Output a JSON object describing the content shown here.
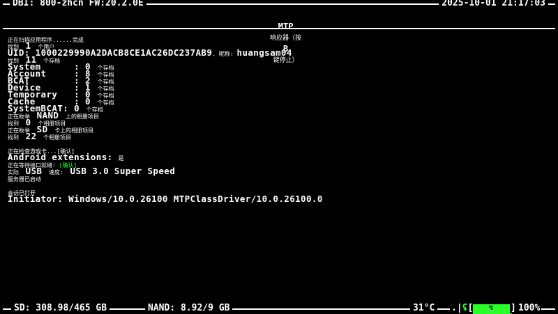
{
  "header": {
    "left": "DBI: 800-zhcn FW:20.2.0E",
    "title": "MTP",
    "subtitle_prefix": "响应器（按",
    "key": "B",
    "subtitle_suffix": "键停止）",
    "datetime": "2025-10-01 21:17:03"
  },
  "log": {
    "scan_apps": "正在扫描应用程序......完成",
    "found_users_pre": "找到",
    "users_count": "1",
    "found_users_post": "个用户",
    "uid_label": "UID: ",
    "uid_value": "1000229990A2DACB8CE1AC26DC237AB9",
    "nick_label": ", 昵称: ",
    "nick_value": "huangsam04",
    "found_saves_pre": "找到",
    "saves_count": "11",
    "found_saves_post": "个存档",
    "save_rows": [
      {
        "name": "System      ",
        "sep": ": ",
        "count": "0",
        "unit": "个存档"
      },
      {
        "name": "Account     ",
        "sep": ": ",
        "count": "8",
        "unit": "个存档"
      },
      {
        "name": "BCAT        ",
        "sep": ": ",
        "count": "2",
        "unit": "个存档"
      },
      {
        "name": "Device      ",
        "sep": ": ",
        "count": "1",
        "unit": "个存档"
      },
      {
        "name": "Temporary   ",
        "sep": ": ",
        "count": "0",
        "unit": "个存档"
      },
      {
        "name": "Cache       ",
        "sep": ": ",
        "count": "0",
        "unit": "个存档"
      },
      {
        "name": "SystemBCAT",
        "sep": ": ",
        "count": "0",
        "unit": "个存档"
      }
    ],
    "enum_nand_pre": "正在枚举",
    "enum_nand_mid": "NAND",
    "enum_nand_post": "上的相册项目",
    "found_album1_pre": "找到",
    "album1_count": "0",
    "found_album1_post": "个相册项目",
    "enum_sd_pre": "正在枚举",
    "enum_sd_mid": "SD",
    "enum_sd_post": "卡上的相册项目",
    "found_album2_pre": "找到",
    "album2_count": "22",
    "found_album2_post": "个相册项目",
    "check_card": "正在检查游戏卡...",
    "confirm1": "[确认]",
    "android_label": "Android extensions: ",
    "android_value": "是",
    "wait_port": "正在等待接口就绪: ",
    "confirm2": "[确认]",
    "actual_label": "实际",
    "usb_label": "USB",
    "speed_label": "速度:",
    "speed_value": "USB 3.0 Super Speed",
    "server_started": "服务器已启动",
    "session_opened": "会话已打开",
    "initiator": "Initiator: Windows/10.0.26100 MTPClassDriver/10.0.26100.0"
  },
  "footer": {
    "sd": "SD: 308.98/465 GB",
    "nand": "NAND: 8.92/9 GB",
    "temp": "31°C",
    "bar_symbol": ".|",
    "open_bracket": "[",
    "close_bracket": "]",
    "battery_pct": "100%",
    "battery_level": 1.0,
    "accent": "#2bff2b"
  }
}
